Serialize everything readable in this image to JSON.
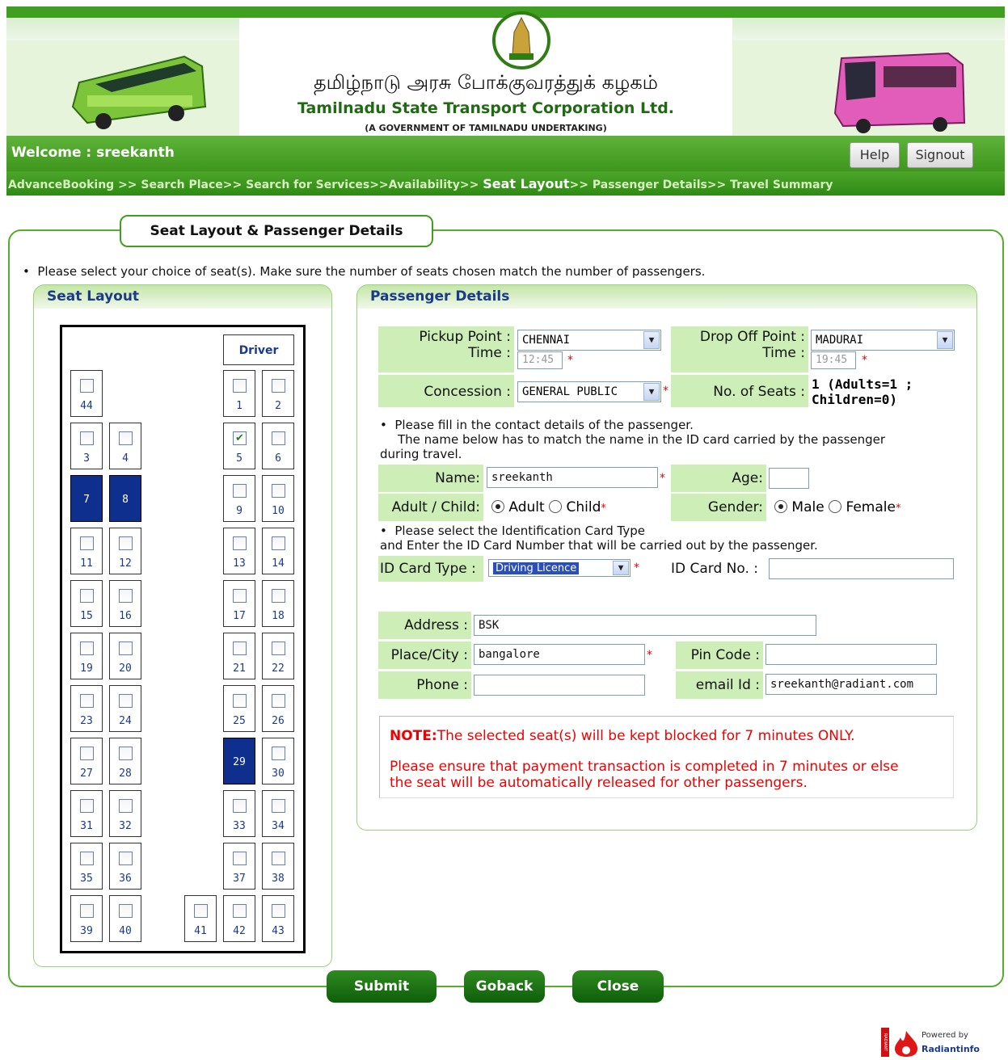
{
  "header": {
    "tamil_title": "தமிழ்நாடு அரசு போக்குவரத்துக் கழகம்",
    "english_title": "Tamilnadu State Transport Corporation Ltd.",
    "subtitle": "(A GOVERNMENT OF TAMILNADU UNDERTAKING)"
  },
  "welcome": "Welcome : sreekanth",
  "buttons": {
    "help": "Help",
    "signout": "Signout"
  },
  "breadcrumb": {
    "before": "AdvanceBooking >> Search Place>> Search for Services>>Availability>> ",
    "current": "Seat Layout",
    "after": ">> Passenger Details>> Travel Summary"
  },
  "section_title": "Seat Layout & Passenger Details",
  "instruction": "Please select your choice of seat(s).  Make sure the number of seats chosen match the number of passengers.",
  "seat_layout": {
    "title": "Seat Layout",
    "driver_label": "Driver",
    "booked_seats": [
      "7",
      "8",
      "29"
    ],
    "selected_seats": [
      "5"
    ]
  },
  "passenger": {
    "title": "Passenger Details",
    "pickup_label": "Pickup Point :",
    "pickup_value": "CHENNAI",
    "time_label": "Time :",
    "pickup_time": "12:45",
    "dropoff_label": "Drop Off Point :",
    "dropoff_value": "MADURAI",
    "dropoff_time": "19:45",
    "concession_label": "Concession :",
    "concession_value": "GENERAL PUBLIC",
    "seats_label": "No. of Seats :",
    "seats_value_1": "1 (Adults=1 ;",
    "seats_value_2": "Children=0)",
    "contact_note_1": "Please fill in the contact details of the passenger.",
    "contact_note_2": "The name below has to match the name in the ID card carried by the passenger",
    "contact_note_3": "during travel.",
    "name_label": "Name:",
    "name_value": "sreekanth",
    "age_label": "Age:",
    "age_value": "",
    "adult_child_label": "Adult / Child:",
    "adult_option": "Adult",
    "child_option": "Child",
    "gender_label": "Gender:",
    "male_option": "Male",
    "female_option": "Female",
    "id_note_1": "Please select the Identification Card Type",
    "id_note_2": "and Enter the ID Card Number that will be carried out by the passenger.",
    "id_type_label": "ID Card Type :",
    "id_type_value": "Driving Licence",
    "id_no_label": "ID Card No. :",
    "id_no_value": "",
    "address_label": "Address :",
    "address_value": "BSK",
    "city_label": "Place/City :",
    "city_value": "bangalore",
    "pin_label": "Pin Code :",
    "pin_value": "",
    "phone_label": "Phone :",
    "phone_value": "",
    "email_label": "email Id :",
    "email_value": "sreekanth@radiant.com"
  },
  "note": {
    "prefix": "NOTE:",
    "line1": "The selected seat(s) will be kept blocked for 7 minutes ONLY.",
    "line2": "Please ensure that payment transaction is completed in 7 minutes or else",
    "line3": "the seat will be automatically released for other passengers."
  },
  "actions": {
    "submit": "Submit",
    "goback": "Goback",
    "close": "Close"
  },
  "footer": {
    "powered_by": "Powered by",
    "brand": "Radiantinfo",
    "logo_side": "RADIANT"
  },
  "colors": {
    "green": "#3f9f20",
    "booked": "#0f2f8f",
    "label_bg": "#cdeeb6",
    "note_red": "#e00000"
  }
}
